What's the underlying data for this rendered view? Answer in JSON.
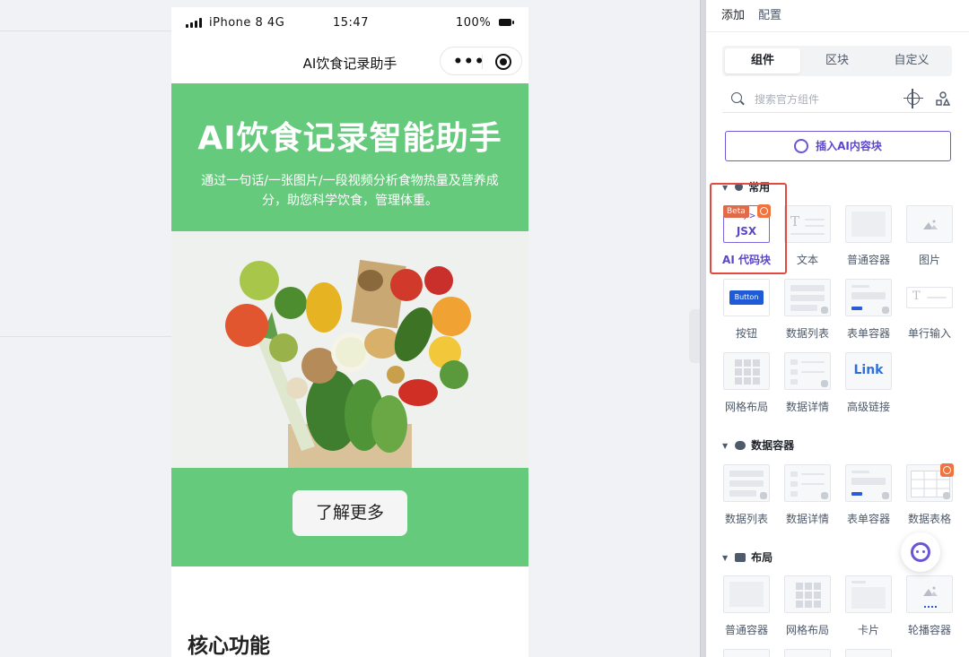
{
  "phone": {
    "status": {
      "carrier": "iPhone 8  4G",
      "time": "15:47",
      "battery": "100%"
    },
    "nav_title": "AI饮食记录助手",
    "hero_title": "AI饮食记录智能助手",
    "hero_subtitle": "通过一句话/一张图片/一段视频分析食物热量及营养成分，助您科学饮食，管理体重。",
    "cta_label": "了解更多",
    "section_title": "核心功能"
  },
  "panel": {
    "tabs": [
      "添加",
      "配置"
    ],
    "segments": [
      "组件",
      "区块",
      "自定义"
    ],
    "search_placeholder": "搜索官方组件",
    "ai_insert_label": "插入AI内容块",
    "sections": {
      "common": "常用",
      "data_container": "数据容器",
      "layout": "布局"
    },
    "beta_badge": "Beta",
    "jsx_tag": "</>",
    "jsx_text": "JSX",
    "mini_button_text": "Button",
    "link_text": "Link",
    "common_items": [
      "AI 代码块",
      "文本",
      "普通容器",
      "图片",
      "按钮",
      "数据列表",
      "表单容器",
      "单行输入",
      "网格布局",
      "数据详情",
      "高级链接"
    ],
    "data_items": [
      "数据列表",
      "数据详情",
      "表单容器",
      "数据表格"
    ],
    "layout_items": [
      "普通容器",
      "网格布局",
      "卡片",
      "轮播容器"
    ]
  },
  "colors": {
    "hero_green": "#66ca7d",
    "accent_purple": "#5b46c9",
    "highlight_red": "#e5483c"
  }
}
